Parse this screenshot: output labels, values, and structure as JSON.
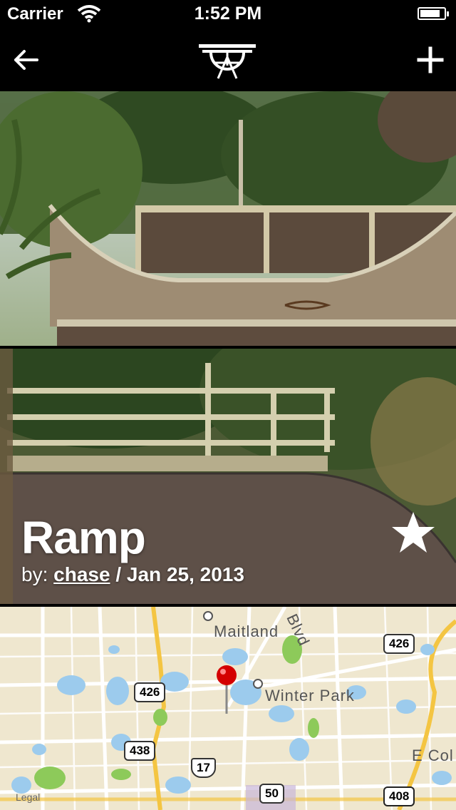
{
  "status_bar": {
    "carrier": "Carrier",
    "time": "1:52 PM",
    "battery_level": 0.85
  },
  "nav": {
    "back_icon": "arrow-left-icon",
    "logo_icon": "ramp-logo-icon",
    "add_icon": "plus-icon"
  },
  "spot": {
    "title": "Ramp",
    "by_label": "by:",
    "username": "chase",
    "separator": "/",
    "date": "Jan 25, 2013",
    "favorite_icon": "star-icon"
  },
  "map": {
    "labels": {
      "maitland": "Maitland",
      "winter_park": "Winter Park",
      "blvd": "Blvd",
      "e_col": "E Col",
      "legal": "Legal"
    },
    "shields": {
      "s426a": "426",
      "s426b": "426",
      "s438": "438",
      "s17": "17",
      "s50": "50",
      "s408": "408"
    },
    "pin_icon": "map-pin-icon"
  },
  "colors": {
    "map_bg": "#efe7cf",
    "water": "#9ccbed",
    "park": "#8dca5a",
    "highway": "#f4c542",
    "pin": "#d40000"
  }
}
